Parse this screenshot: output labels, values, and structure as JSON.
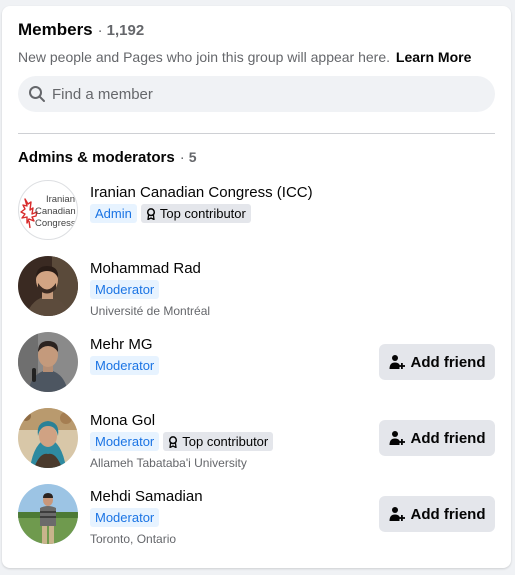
{
  "members": {
    "title": "Members",
    "separator": "·",
    "count": "1,192",
    "subtitle": "New people and Pages who join this group will appear here.",
    "learn_more": "Learn More"
  },
  "search": {
    "placeholder": "Find a member"
  },
  "section": {
    "title": "Admins & moderators",
    "separator": "·",
    "count": "5"
  },
  "people": [
    {
      "name": "Iranian Canadian Congress (ICC)",
      "role": "Admin",
      "top_contributor": "Top contributor",
      "logo_lines": [
        "Iranian",
        "Canadian",
        "Congress"
      ]
    },
    {
      "name": "Mohammad Rad",
      "role": "Moderator",
      "subline": "Université de Montréal"
    },
    {
      "name": "Mehr MG",
      "role": "Moderator",
      "button": "Add friend"
    },
    {
      "name": "Mona Gol",
      "role": "Moderator",
      "top_contributor": "Top contributor",
      "subline": "Allameh Tabataba'i University",
      "button": "Add friend"
    },
    {
      "name": "Mehdi Samadian",
      "role": "Moderator",
      "subline": "Toronto, Ontario",
      "button": "Add friend"
    }
  ],
  "colors": {
    "accent": "#1b74e4",
    "badge_bg": "#e7f3ff",
    "button_bg": "#e4e6eb",
    "logo_red": "#d82c2c"
  }
}
